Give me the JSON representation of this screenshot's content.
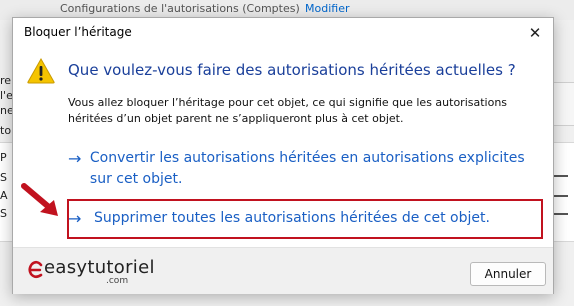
{
  "background_window": {
    "top_text": "Configurations de l'autorisations (Comptes)",
    "top_link": "Modifier",
    "left_fragments": [
      "re",
      "l'e",
      "ne",
      "torisa",
      "P",
      "S",
      "A",
      "S"
    ]
  },
  "dialog": {
    "title": "Bloquer l’héritage",
    "close_glyph": "✕",
    "heading": "Que voulez-vous faire des autorisations héritées actuelles ?",
    "description": "Vous allez bloquer l’héritage pour cet objet, ce qui signifie que les autorisations héritées d’un objet parent ne s’appliqueront plus à cet objet.",
    "options": [
      {
        "arrow": "→",
        "label": "Convertir les autorisations héritées en autorisations explicites sur cet objet."
      },
      {
        "arrow": "→",
        "label": "Supprimer toutes les autorisations héritées de cet objet."
      }
    ],
    "cancel_label": "Annuler"
  },
  "logo": {
    "main": "easytutoriel",
    "sub": ".com"
  },
  "colors": {
    "link_blue": "#1a5fc4",
    "heading_blue": "#1a3f9a",
    "highlight_red": "#c1121f",
    "warning_yellow": "#f5c400"
  },
  "icons": {
    "warning": "warning-icon",
    "close": "close-icon",
    "annotation_arrow": "red-arrow-icon"
  }
}
